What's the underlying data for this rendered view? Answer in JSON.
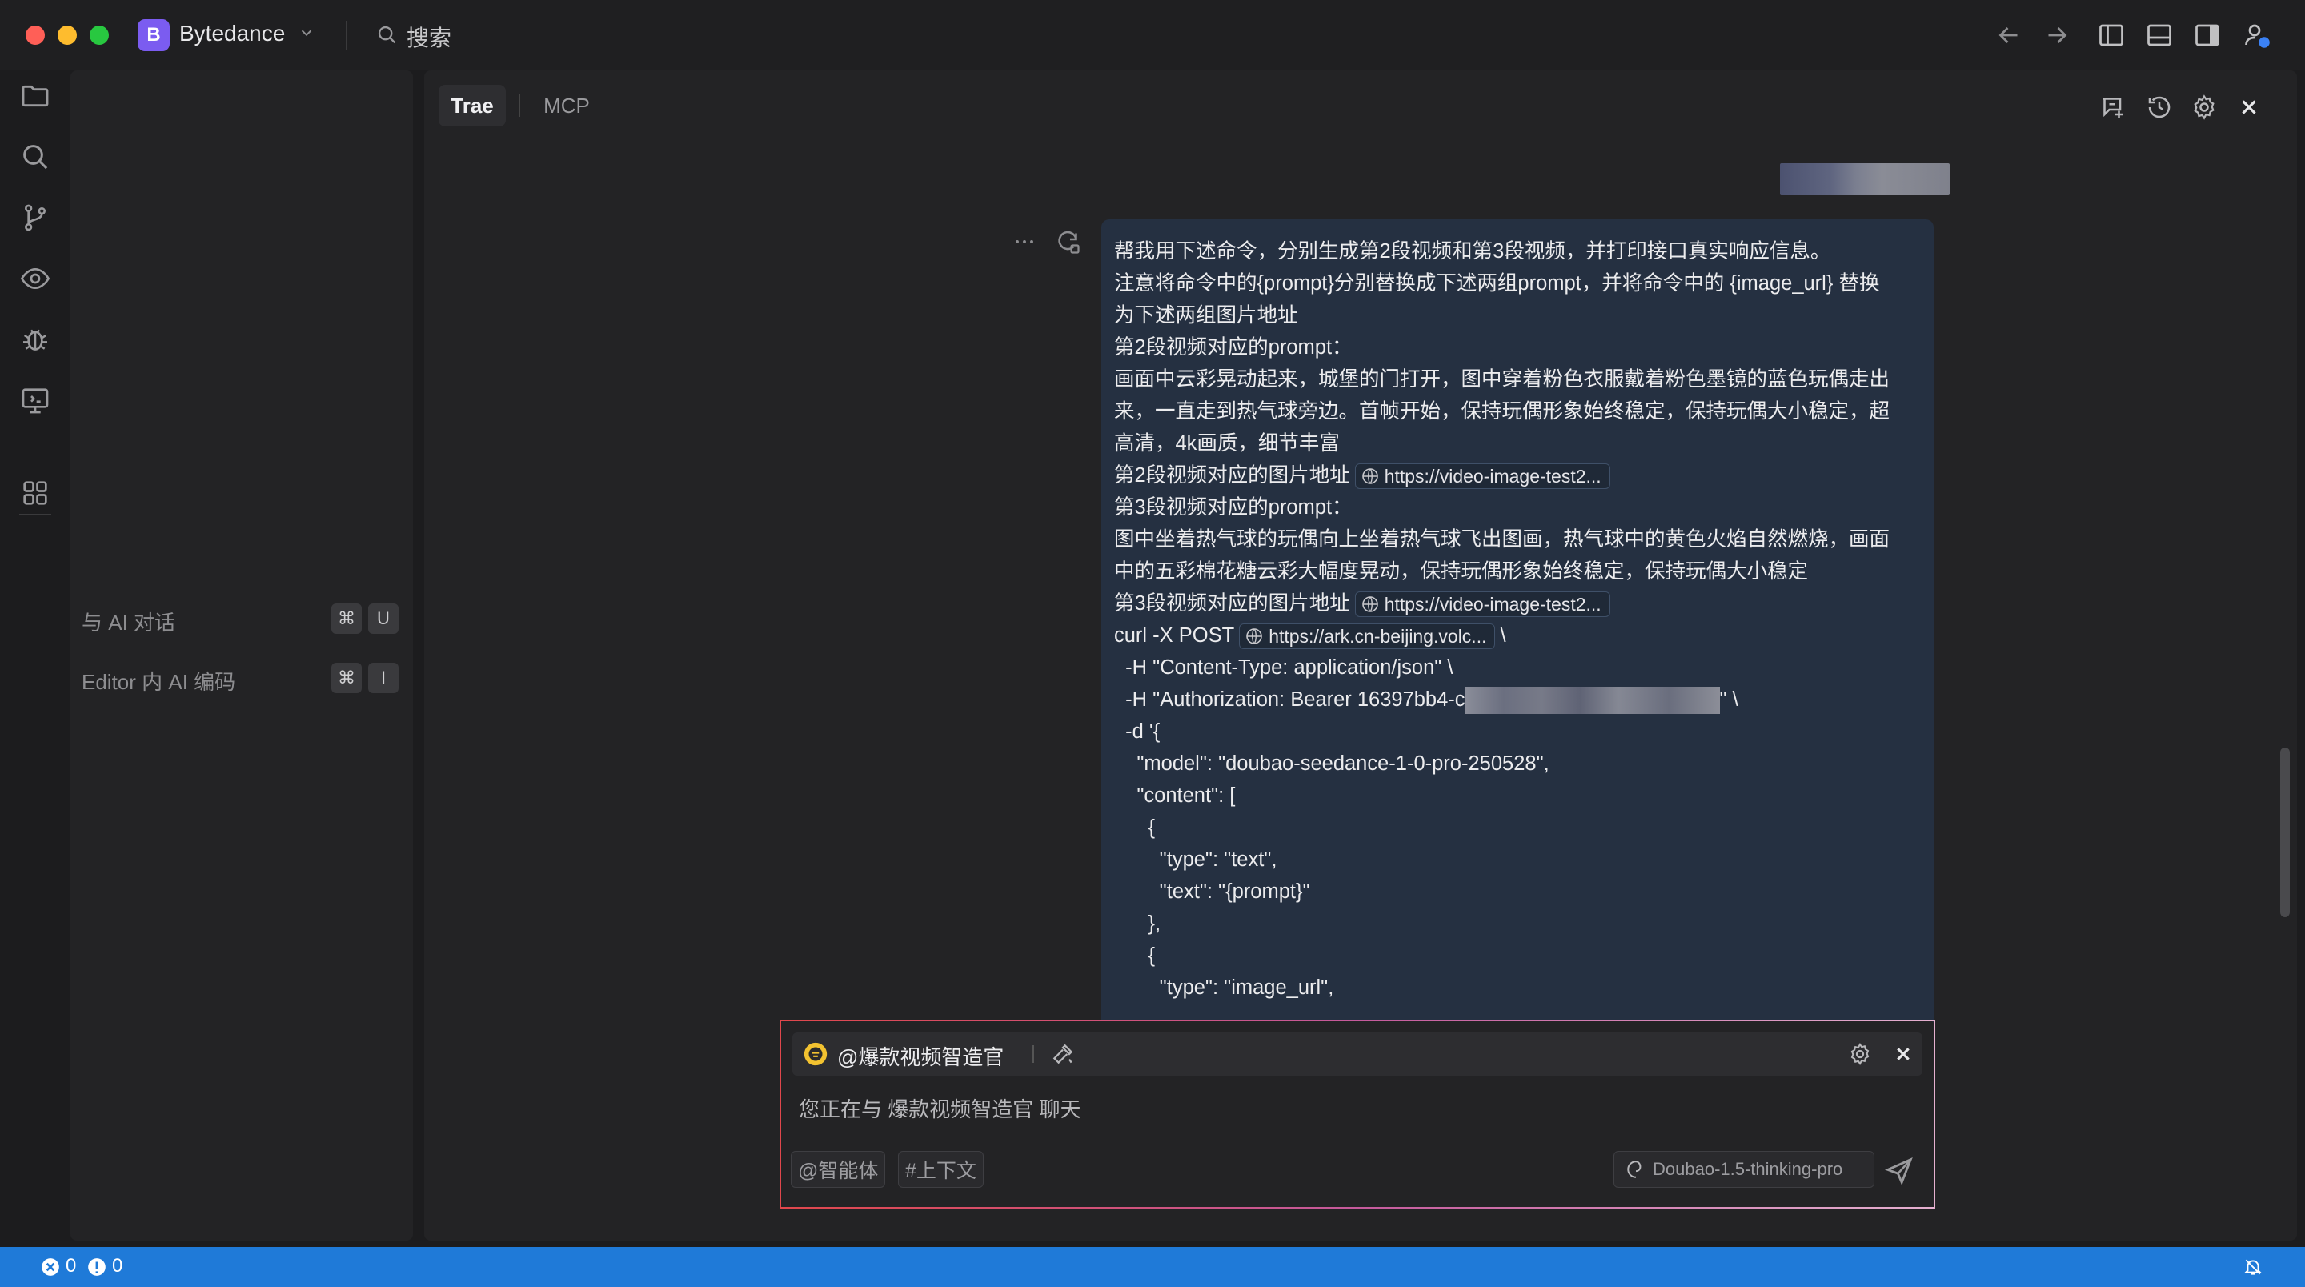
{
  "colors": {
    "accent": "#1f7ad8",
    "workspace_badge": "#7b5cf0",
    "bubble": "#253041"
  },
  "window": {
    "workspace_initial": "B",
    "workspace_name": "Bytedance",
    "search_label": "搜索"
  },
  "sidebar": {
    "chat_label": "与 AI 对话",
    "chat_keys": [
      "⌘",
      "U"
    ],
    "editor_label": "Editor 内 AI 编码",
    "editor_keys": [
      "⌘",
      "I"
    ]
  },
  "main": {
    "tabs": [
      {
        "label": "Trae",
        "active": true
      },
      {
        "label": "MCP",
        "active": false
      }
    ]
  },
  "message": {
    "l1": "帮我用下述命令，分别生成第2段视频和第3段视频，并打印接口真实响应信息。",
    "l2": "注意将命令中的{prompt}分别替换成下述两组prompt，并将命令中的 {image_url} 替换",
    "l3": "为下述两组图片地址",
    "l4": "第2段视频对应的prompt：",
    "l5": "画面中云彩晃动起来，城堡的门打开，图中穿着粉色衣服戴着粉色墨镜的蓝色玩偶走出",
    "l6": "来，一直走到热气球旁边。首帧开始，保持玩偶形象始终稳定，保持玩偶大小稳定，超",
    "l7": "高清，4k画质，细节丰富",
    "l8": "第2段视频对应的图片地址",
    "chip1": "https://video-image-test2...",
    "l9": "第3段视频对应的prompt：",
    "l10": "图中坐着热气球的玩偶向上坐着热气球飞出图画，热气球中的黄色火焰自然燃烧，画面",
    "l11": "中的五彩棉花糖云彩大幅度晃动，保持玩偶形象始终稳定，保持玩偶大小稳定",
    "l12": "第3段视频对应的图片地址",
    "chip2": "https://video-image-test2...",
    "l13": "curl -X POST",
    "chip3": "https://ark.cn-beijing.volc...",
    "l13_tail": "\\",
    "l14": "  -H \"Content-Type: application/json\" \\",
    "l15": "  -H \"Authorization: Bearer 16397bb4-c",
    "l15_tail": "\" \\",
    "l16": "  -d '{",
    "l17": "    \"model\": \"doubao-seedance-1-0-pro-250528\",",
    "l18": "    \"content\": [",
    "l19": "      {",
    "l20": "        \"type\": \"text\",",
    "l21": "        \"text\": \"{prompt}\"",
    "l22": "      },",
    "l23": "      {",
    "l24": "        \"type\": \"image_url\","
  },
  "composer": {
    "agent": "@爆款视频智造官",
    "status": "您正在与 爆款视频智造官 聊天",
    "agent_pill": "@智能体",
    "context_pill": "#上下文",
    "model": "Doubao-1.5-thinking-pro"
  },
  "status": {
    "errors": "0",
    "warnings": "0"
  }
}
